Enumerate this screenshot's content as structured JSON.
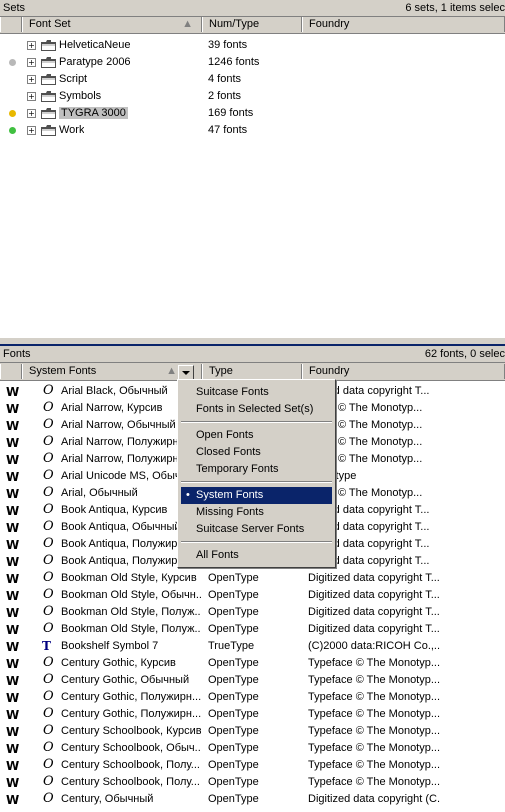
{
  "sets_panel": {
    "title": "Sets",
    "status": "6 sets,     1 items selec",
    "columns": [
      "Font Set",
      "Num/Type",
      "Foundry"
    ],
    "rows": [
      {
        "name": "HelveticaNeue",
        "count": "39 fonts",
        "dot": ""
      },
      {
        "name": "Paratype 2006",
        "count": "1246 fonts",
        "dot": "#b8b8b8"
      },
      {
        "name": "Script",
        "count": "4 fonts",
        "dot": ""
      },
      {
        "name": "Symbols",
        "count": "2 fonts",
        "dot": ""
      },
      {
        "name": "TYGRA 3000",
        "count": "169 fonts",
        "dot": "#e8b800",
        "selected": true
      },
      {
        "name": "Work",
        "count": "47 fonts",
        "dot": "#40c040"
      }
    ]
  },
  "fonts_panel": {
    "title": "Fonts",
    "status": "62 fonts,     0 selec",
    "columns": [
      "System Fonts",
      "Type",
      "Foundry"
    ],
    "rows": [
      {
        "name": "Arial Black, Обычный",
        "type": "",
        "foundry": "gitized data copyright T...",
        "icon": "O"
      },
      {
        "name": "Arial Narrow, Курсив",
        "type": "",
        "foundry": "eface © The Monotyp...",
        "icon": "O"
      },
      {
        "name": "Arial Narrow, Обычный",
        "type": "",
        "foundry": "eface © The Monotyp...",
        "icon": "O"
      },
      {
        "name": "Arial Narrow, Полужирн...",
        "type": "",
        "foundry": "eface © The Monotyp...",
        "icon": "O"
      },
      {
        "name": "Arial Narrow, Полужирн...",
        "type": "",
        "foundry": "eface © The Monotyp...",
        "icon": "O"
      },
      {
        "name": "Arial Unicode MS, Обыч...",
        "type": "",
        "foundry": "Monotype",
        "icon": "O"
      },
      {
        "name": "Arial, Обычный",
        "type": "",
        "foundry": "eface © The Monotyp...",
        "icon": "O"
      },
      {
        "name": "Book Antiqua, Курсив",
        "type": "",
        "foundry": "gitized data copyright T...",
        "icon": "O"
      },
      {
        "name": "Book Antiqua, Обычный",
        "type": "",
        "foundry": "gitized data copyright T...",
        "icon": "O"
      },
      {
        "name": "Book Antiqua, Полужир...",
        "type": "",
        "foundry": "gitized data copyright T...",
        "icon": "O"
      },
      {
        "name": "Book Antiqua, Полужир...",
        "type": "",
        "foundry": "gitized data copyright T...",
        "icon": "O"
      },
      {
        "name": "Bookman Old Style, Курсив",
        "type": "OpenType",
        "foundry": "Digitized data copyright T...",
        "icon": "O"
      },
      {
        "name": "Bookman Old Style, Обычн...",
        "type": "OpenType",
        "foundry": "Digitized data copyright T...",
        "icon": "O"
      },
      {
        "name": "Bookman Old Style, Полуж...",
        "type": "OpenType",
        "foundry": "Digitized data copyright T...",
        "icon": "O"
      },
      {
        "name": "Bookman Old Style, Полуж...",
        "type": "OpenType",
        "foundry": "Digitized data copyright T...",
        "icon": "O"
      },
      {
        "name": "Bookshelf Symbol 7",
        "type": "TrueType",
        "foundry": "(C)2000 data:RICOH Co.,...",
        "icon": "T"
      },
      {
        "name": "Century Gothic, Курсив",
        "type": "OpenType",
        "foundry": "Typeface © The Monotyp...",
        "icon": "O"
      },
      {
        "name": "Century Gothic, Обычный",
        "type": "OpenType",
        "foundry": "Typeface © The Monotyp...",
        "icon": "O"
      },
      {
        "name": "Century Gothic, Полужирн...",
        "type": "OpenType",
        "foundry": "Typeface © The Monotyp...",
        "icon": "O"
      },
      {
        "name": "Century Gothic, Полужирн...",
        "type": "OpenType",
        "foundry": "Typeface © The Monotyp...",
        "icon": "O"
      },
      {
        "name": "Century Schoolbook, Курсив",
        "type": "OpenType",
        "foundry": "Typeface © The Monotyp...",
        "icon": "O"
      },
      {
        "name": "Century Schoolbook, Обыч...",
        "type": "OpenType",
        "foundry": "Typeface © The Monotyp...",
        "icon": "O"
      },
      {
        "name": "Century Schoolbook, Полу...",
        "type": "OpenType",
        "foundry": "Typeface © The Monotyp...",
        "icon": "O"
      },
      {
        "name": "Century Schoolbook, Полу...",
        "type": "OpenType",
        "foundry": "Typeface © The Monotyp...",
        "icon": "O"
      },
      {
        "name": "Century, Обычный",
        "type": "OpenType",
        "foundry": "Digitized data copyright (C...",
        "icon": "O"
      }
    ]
  },
  "dropdown_menu": {
    "groups": [
      [
        "Suitcase Fonts",
        "Fonts in Selected Set(s)"
      ],
      [
        "Open Fonts",
        "Closed Fonts",
        "Temporary Fonts"
      ],
      [
        "System Fonts",
        "Missing Fonts",
        "Suitcase Server Fonts"
      ],
      [
        "All Fonts"
      ]
    ],
    "selected": "System Fonts"
  }
}
